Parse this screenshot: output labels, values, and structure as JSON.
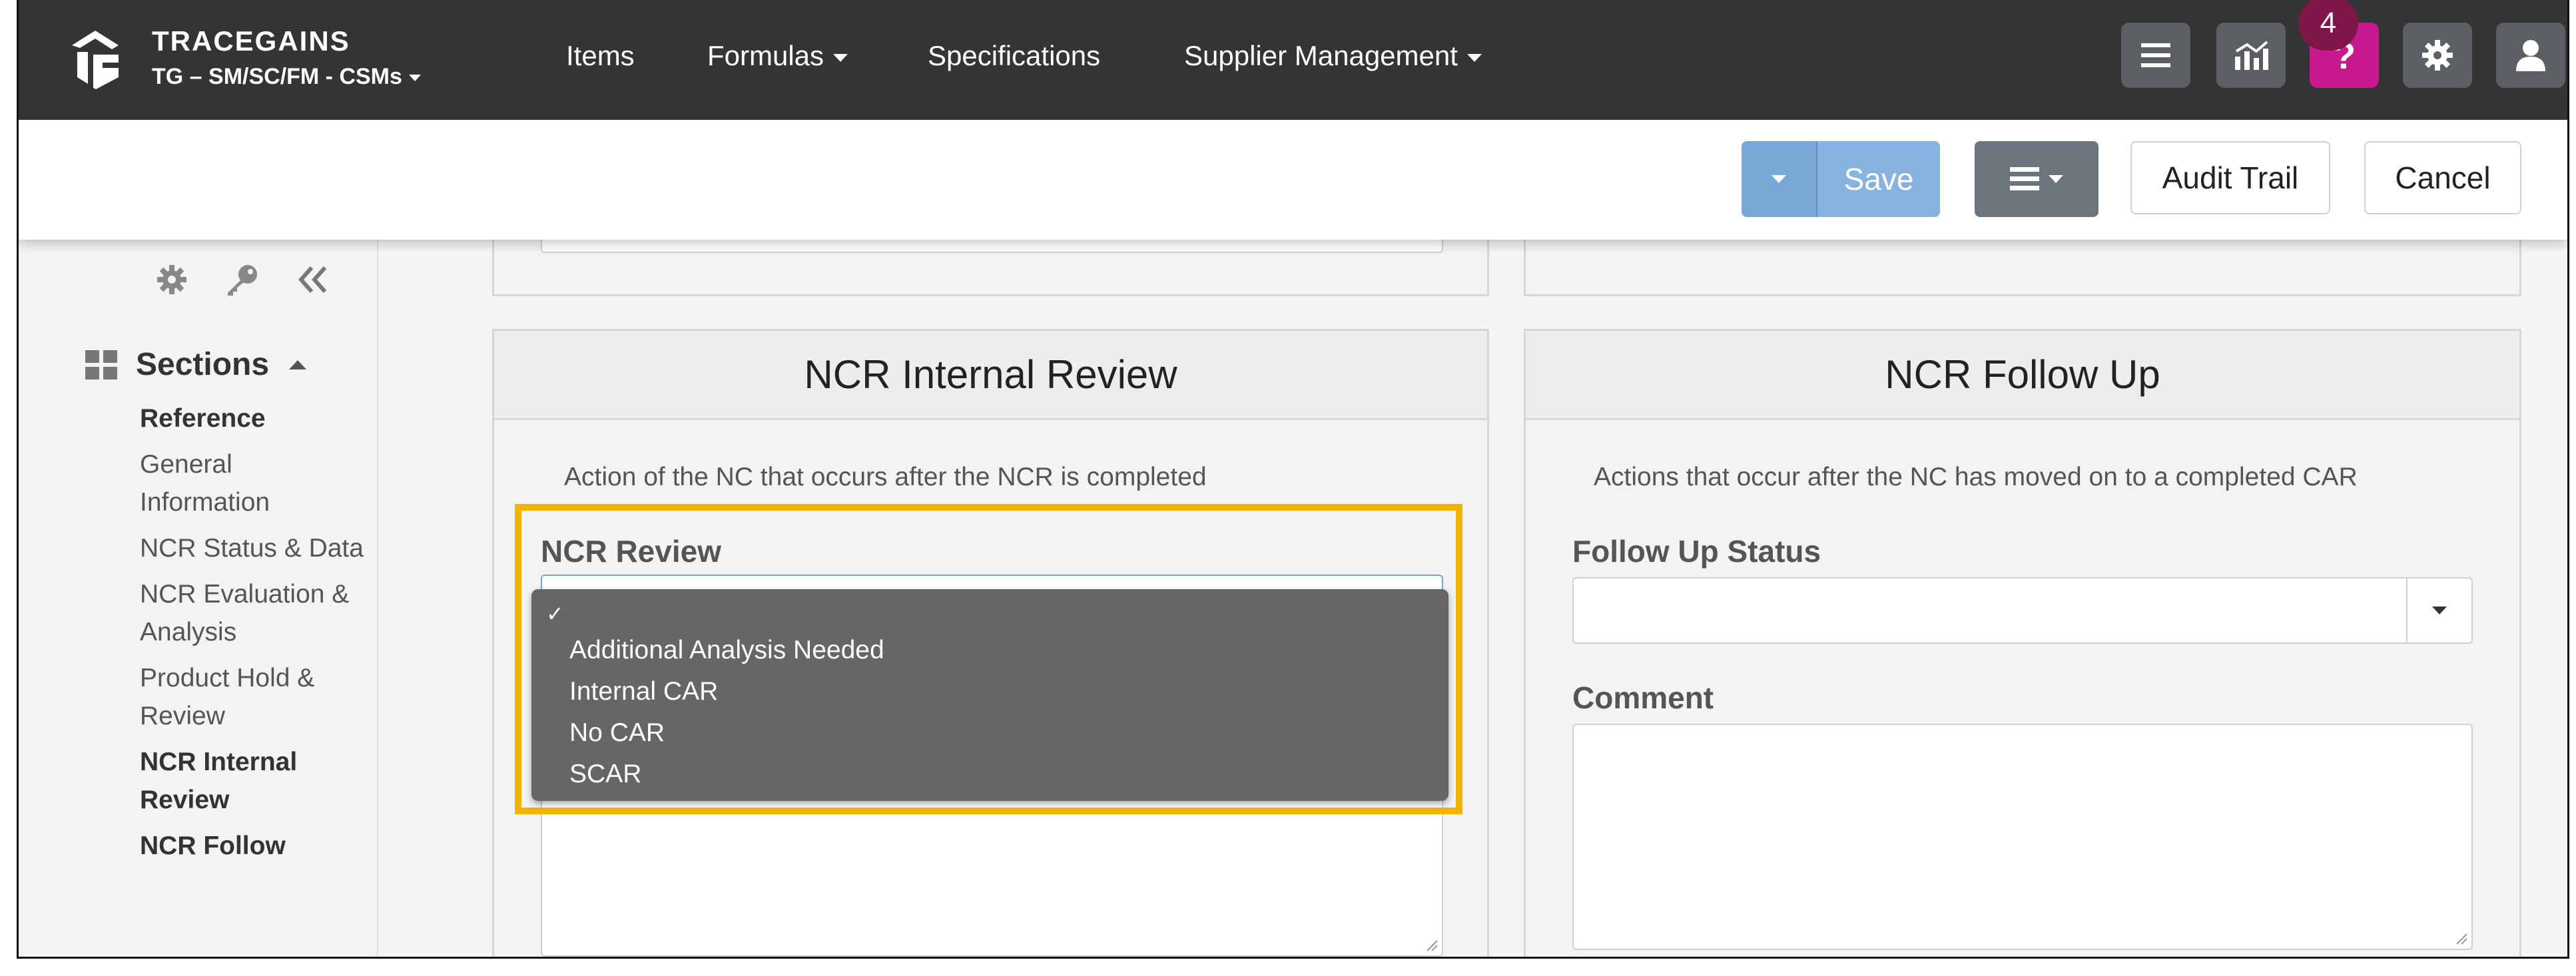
{
  "brand": {
    "title": "TRACEGAINS",
    "subtitle": "TG – SM/SC/FM - CSMs"
  },
  "nav": {
    "items": [
      {
        "label": "Items"
      },
      {
        "label": "Formulas"
      },
      {
        "label": "Specifications"
      },
      {
        "label": "Supplier Management"
      }
    ],
    "notification_count": "4"
  },
  "toolbar": {
    "save_label": "Save",
    "audit_trail_label": "Audit Trail",
    "cancel_label": "Cancel"
  },
  "sidebar": {
    "sections_label": "Sections",
    "links": [
      {
        "label": "Reference",
        "bold": true
      },
      {
        "label": "General Information",
        "bold": false
      },
      {
        "label": "NCR Status & Data",
        "bold": false
      },
      {
        "label": "NCR Evaluation & Analysis",
        "bold": false
      },
      {
        "label": "Product Hold & Review",
        "bold": false
      },
      {
        "label": "NCR Internal Review",
        "bold": true
      },
      {
        "label": "NCR Follow",
        "bold": true
      }
    ]
  },
  "internal_review": {
    "title": "NCR Internal Review",
    "description": "Action of the NC that occurs after the NCR is completed",
    "field_label": "NCR Review",
    "selected_value": "",
    "options": [
      "Additional Analysis Needed",
      "Internal CAR",
      "No CAR",
      "SCAR"
    ]
  },
  "follow_up": {
    "title": "NCR Follow Up",
    "description": "Actions that occur after the NC has moved on to a completed CAR",
    "status_label": "Follow Up Status",
    "status_value": "",
    "comment_label": "Comment",
    "comment_value": ""
  },
  "colors": {
    "topnav_bg": "#333436",
    "help_button": "#c8188f",
    "badge": "#7e1747",
    "save_button": "#86b3e0",
    "menu_button": "#6c757d",
    "highlight": "#f5b301",
    "dropdown_bg": "#676566"
  },
  "icons": [
    "logo-icon",
    "hamburger-icon",
    "analytics-icon",
    "help-icon",
    "gear-icon",
    "user-icon",
    "chevron-down-icon",
    "list-icon",
    "key-icon",
    "collapse-double-chevron-icon",
    "grid-icon",
    "caret-up-icon",
    "checkmark-icon"
  ]
}
